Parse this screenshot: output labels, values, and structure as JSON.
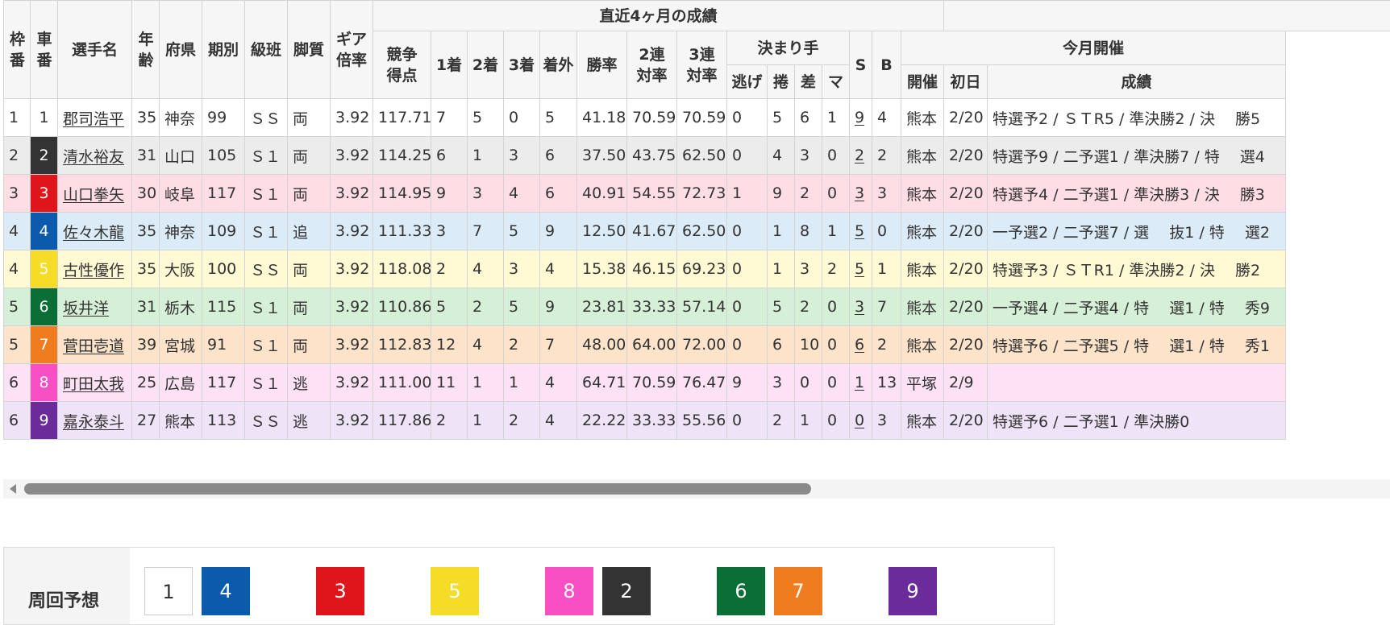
{
  "headers": {
    "waku": "枠番",
    "sha": "車番",
    "name": "選手名",
    "age": "年齢",
    "pref": "府県",
    "term": "期別",
    "class": "級班",
    "style": "脚質",
    "gear": "ギア倍率",
    "recent": "直近4ヶ月の成績",
    "score": "競争得点",
    "first": "1着",
    "second": "2着",
    "third": "3着",
    "out": "着外",
    "win_rate": "勝率",
    "ren2": "2連対率",
    "ren3": "3連対率",
    "kimarite": "決まり手",
    "nige": "逃げ",
    "makuri": "捲",
    "sashi": "差",
    "mark": "マ",
    "s": "S",
    "b": "B",
    "month": "今月開催",
    "venue": "開催",
    "first_day": "初日",
    "results": "成績"
  },
  "riders": [
    {
      "waku": "1",
      "car": "1",
      "name": "郡司浩平",
      "age": "35",
      "pref": "神奈",
      "term": "99",
      "cls": "ＳＳ",
      "style": "両",
      "gear": "3.92",
      "score": "117.71",
      "f1": "7",
      "f2": "5",
      "f3": "0",
      "out": "5",
      "win": "41.18",
      "r2": "70.59",
      "r3": "70.59",
      "nige": "0",
      "makuri": "5",
      "sashi": "6",
      "mark": "1",
      "s": "9",
      "b": "4",
      "venue": "熊本",
      "day": "2/20",
      "result": "特選予2 / ＳＴR5 / 準決勝2 / 決　 勝5"
    },
    {
      "waku": "2",
      "car": "2",
      "name": "清水裕友",
      "age": "31",
      "pref": "山口",
      "term": "105",
      "cls": "Ｓ１",
      "style": "両",
      "gear": "3.92",
      "score": "114.25",
      "f1": "6",
      "f2": "1",
      "f3": "3",
      "out": "6",
      "win": "37.50",
      "r2": "43.75",
      "r3": "62.50",
      "nige": "0",
      "makuri": "4",
      "sashi": "3",
      "mark": "0",
      "s": "2",
      "b": "2",
      "venue": "熊本",
      "day": "2/20",
      "result": "特選予9 / 二予選1 / 準決勝7 / 特　 選4"
    },
    {
      "waku": "3",
      "car": "3",
      "name": "山口拳矢",
      "age": "30",
      "pref": "岐阜",
      "term": "117",
      "cls": "Ｓ１",
      "style": "両",
      "gear": "3.92",
      "score": "114.95",
      "f1": "9",
      "f2": "3",
      "f3": "4",
      "out": "6",
      "win": "40.91",
      "r2": "54.55",
      "r3": "72.73",
      "nige": "1",
      "makuri": "9",
      "sashi": "2",
      "mark": "0",
      "s": "3",
      "b": "3",
      "venue": "熊本",
      "day": "2/20",
      "result": "特選予4 / 二予選1 / 準決勝3 / 決　 勝3"
    },
    {
      "waku": "4",
      "car": "4",
      "name": "佐々木龍",
      "age": "35",
      "pref": "神奈",
      "term": "109",
      "cls": "Ｓ１",
      "style": "追",
      "gear": "3.92",
      "score": "111.33",
      "f1": "3",
      "f2": "7",
      "f3": "5",
      "out": "9",
      "win": "12.50",
      "r2": "41.67",
      "r3": "62.50",
      "nige": "0",
      "makuri": "1",
      "sashi": "8",
      "mark": "1",
      "s": "5",
      "b": "0",
      "venue": "熊本",
      "day": "2/20",
      "result": "一予選2 / 二予選7 / 選　 抜1 / 特　 選2"
    },
    {
      "waku": "4",
      "car": "5",
      "name": "古性優作",
      "age": "35",
      "pref": "大阪",
      "term": "100",
      "cls": "ＳＳ",
      "style": "両",
      "gear": "3.92",
      "score": "118.08",
      "f1": "2",
      "f2": "4",
      "f3": "3",
      "out": "4",
      "win": "15.38",
      "r2": "46.15",
      "r3": "69.23",
      "nige": "0",
      "makuri": "1",
      "sashi": "3",
      "mark": "2",
      "s": "5",
      "b": "1",
      "venue": "熊本",
      "day": "2/20",
      "result": "特選予3 / ＳＴR1 / 準決勝2 / 決　 勝2"
    },
    {
      "waku": "5",
      "car": "6",
      "name": "坂井洋",
      "age": "31",
      "pref": "栃木",
      "term": "115",
      "cls": "Ｓ１",
      "style": "両",
      "gear": "3.92",
      "score": "110.86",
      "f1": "5",
      "f2": "2",
      "f3": "5",
      "out": "9",
      "win": "23.81",
      "r2": "33.33",
      "r3": "57.14",
      "nige": "0",
      "makuri": "5",
      "sashi": "2",
      "mark": "0",
      "s": "3",
      "b": "7",
      "venue": "熊本",
      "day": "2/20",
      "result": "一予選4 / 二予選4 / 特　 選1 / 特　 秀9"
    },
    {
      "waku": "5",
      "car": "7",
      "name": "菅田壱道",
      "age": "39",
      "pref": "宮城",
      "term": "91",
      "cls": "Ｓ１",
      "style": "両",
      "gear": "3.92",
      "score": "112.83",
      "f1": "12",
      "f2": "4",
      "f3": "2",
      "out": "7",
      "win": "48.00",
      "r2": "64.00",
      "r3": "72.00",
      "nige": "0",
      "makuri": "6",
      "sashi": "10",
      "mark": "0",
      "s": "6",
      "b": "2",
      "venue": "熊本",
      "day": "2/20",
      "result": "特選予6 / 二予選5 / 特　 選1 / 特　 秀1"
    },
    {
      "waku": "6",
      "car": "8",
      "name": "町田太我",
      "age": "25",
      "pref": "広島",
      "term": "117",
      "cls": "Ｓ１",
      "style": "逃",
      "gear": "3.92",
      "score": "111.00",
      "f1": "11",
      "f2": "1",
      "f3": "1",
      "out": "4",
      "win": "64.71",
      "r2": "70.59",
      "r3": "76.47",
      "nige": "9",
      "makuri": "3",
      "sashi": "0",
      "mark": "0",
      "s": "1",
      "b": "13",
      "venue": "平塚",
      "day": "2/9",
      "result": ""
    },
    {
      "waku": "6",
      "car": "9",
      "name": "嘉永泰斗",
      "age": "27",
      "pref": "熊本",
      "term": "113",
      "cls": "ＳＳ",
      "style": "逃",
      "gear": "3.92",
      "score": "117.86",
      "f1": "2",
      "f2": "1",
      "f3": "2",
      "out": "4",
      "win": "22.22",
      "r2": "33.33",
      "r3": "55.56",
      "nige": "0",
      "makuri": "2",
      "sashi": "1",
      "mark": "0",
      "s": "0",
      "b": "3",
      "venue": "熊本",
      "day": "2/20",
      "result": "特選予6 / 二予選1 / 準決勝0"
    }
  ],
  "car_colors": {
    "1": {
      "bg": "#ffffff",
      "fg": "#333333",
      "row": "#ffffff"
    },
    "2": {
      "bg": "#333333",
      "fg": "#ffffff",
      "row": "#ececec"
    },
    "3": {
      "bg": "#e0151c",
      "fg": "#ffffff",
      "row": "#ffdde4"
    },
    "4": {
      "bg": "#0b5aab",
      "fg": "#ffffff",
      "row": "#dcebf8"
    },
    "5": {
      "bg": "#f5dd27",
      "fg": "#ffffff",
      "row": "#fff9d4"
    },
    "6": {
      "bg": "#0a6e36",
      "fg": "#ffffff",
      "row": "#d6f0d8"
    },
    "7": {
      "bg": "#ef7d1f",
      "fg": "#ffffff",
      "row": "#fde3c9"
    },
    "8": {
      "bg": "#f94fc5",
      "fg": "#ffffff",
      "row": "#fde1f5"
    },
    "9": {
      "bg": "#6c2b9a",
      "fg": "#ffffff",
      "row": "#eee3f7"
    }
  },
  "laps": {
    "label": "周回予想",
    "order": [
      "1",
      "4",
      "3",
      "5",
      "8",
      "2",
      "6",
      "7",
      "9"
    ]
  }
}
